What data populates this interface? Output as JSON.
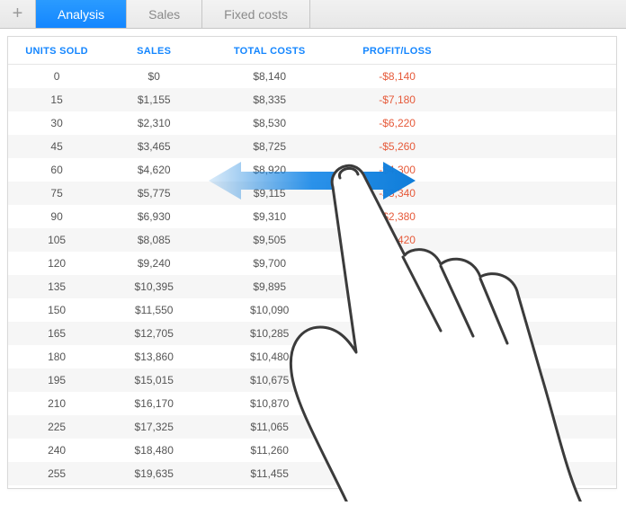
{
  "tabs": [
    {
      "label": "Analysis",
      "active": true
    },
    {
      "label": "Sales",
      "active": false
    },
    {
      "label": "Fixed costs",
      "active": false
    }
  ],
  "table": {
    "columns": [
      "UNITS SOLD",
      "SALES",
      "TOTAL COSTS",
      "PROFIT/LOSS"
    ],
    "rows": [
      {
        "units": "0",
        "sales": "$0",
        "costs": "$8,140",
        "pl": "-$8,140",
        "sign": "neg"
      },
      {
        "units": "15",
        "sales": "$1,155",
        "costs": "$8,335",
        "pl": "-$7,180",
        "sign": "neg"
      },
      {
        "units": "30",
        "sales": "$2,310",
        "costs": "$8,530",
        "pl": "-$6,220",
        "sign": "neg"
      },
      {
        "units": "45",
        "sales": "$3,465",
        "costs": "$8,725",
        "pl": "-$5,260",
        "sign": "neg"
      },
      {
        "units": "60",
        "sales": "$4,620",
        "costs": "$8,920",
        "pl": "-$4,300",
        "sign": "neg"
      },
      {
        "units": "75",
        "sales": "$5,775",
        "costs": "$9,115",
        "pl": "-$3,340",
        "sign": "neg"
      },
      {
        "units": "90",
        "sales": "$6,930",
        "costs": "$9,310",
        "pl": "-$2,380",
        "sign": "neg"
      },
      {
        "units": "105",
        "sales": "$8,085",
        "costs": "$9,505",
        "pl": "-$1,420",
        "sign": "neg"
      },
      {
        "units": "120",
        "sales": "$9,240",
        "costs": "$9,700",
        "pl": "",
        "sign": ""
      },
      {
        "units": "135",
        "sales": "$10,395",
        "costs": "$9,895",
        "pl": "",
        "sign": ""
      },
      {
        "units": "150",
        "sales": "$11,550",
        "costs": "$10,090",
        "pl": "",
        "sign": ""
      },
      {
        "units": "165",
        "sales": "$12,705",
        "costs": "$10,285",
        "pl": "",
        "sign": ""
      },
      {
        "units": "180",
        "sales": "$13,860",
        "costs": "$10,480",
        "pl": "",
        "sign": ""
      },
      {
        "units": "195",
        "sales": "$15,015",
        "costs": "$10,675",
        "pl": "",
        "sign": ""
      },
      {
        "units": "210",
        "sales": "$16,170",
        "costs": "$10,870",
        "pl": "",
        "sign": ""
      },
      {
        "units": "225",
        "sales": "$17,325",
        "costs": "$11,065",
        "pl": "",
        "sign": ""
      },
      {
        "units": "240",
        "sales": "$18,480",
        "costs": "$11,260",
        "pl": "",
        "sign": ""
      },
      {
        "units": "255",
        "sales": "$19,635",
        "costs": "$11,455",
        "pl": "",
        "sign": ""
      }
    ]
  },
  "colors": {
    "accent": "#1486ff",
    "negative": "#e65a3a",
    "positive": "#3aa84f"
  }
}
